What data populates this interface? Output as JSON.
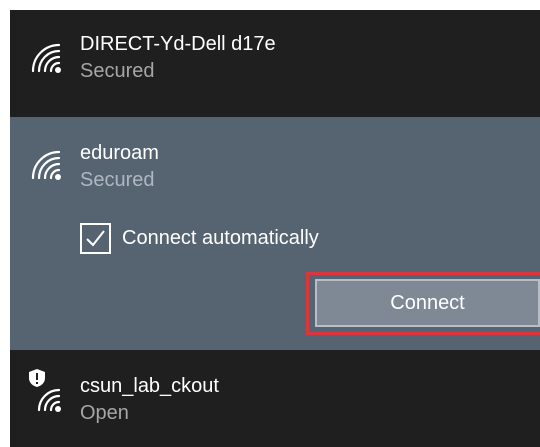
{
  "networks": [
    {
      "name": "DIRECT-Yd-Dell d17e",
      "status": "Secured",
      "icon": "wifi-icon"
    },
    {
      "name": "eduroam",
      "status": "Secured",
      "icon": "wifi-icon",
      "selected": true,
      "auto_connect_label": "Connect automatically",
      "auto_connect_checked": true,
      "connect_label": "Connect"
    },
    {
      "name": "csun_lab_ckout",
      "status": "Open",
      "icon": "wifi-warning-icon"
    }
  ],
  "colors": {
    "panel_bg": "#1f1f1f",
    "selected_bg": "#566371",
    "button_bg": "#7f8996",
    "highlight_border": "#d9363e",
    "secondary_text": "#a6a6a6"
  }
}
